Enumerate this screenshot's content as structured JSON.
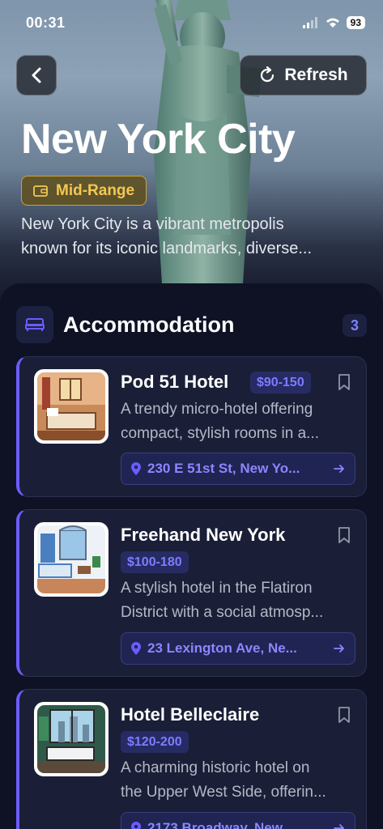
{
  "status_bar": {
    "time": "00:31",
    "battery": "93"
  },
  "header": {
    "refresh_label": "Refresh",
    "city": "New York City",
    "tier": "Mid-Range",
    "description_line1": "New York City is a vibrant metropolis",
    "description_line2": "known for its iconic landmarks, diverse..."
  },
  "section": {
    "title": "Accommodation",
    "count": "3"
  },
  "hotels": [
    {
      "name": "Pod 51 Hotel",
      "price": "$90-150",
      "desc_line1": "A trendy micro-hotel offering",
      "desc_line2": "compact, stylish rooms in a...",
      "address": "230 E 51st St, New Yo..."
    },
    {
      "name": "Freehand New York",
      "price": "$100-180",
      "desc_line1": "A stylish hotel in the Flatiron",
      "desc_line2": "District with a social atmosp...",
      "address": "23 Lexington Ave, Ne..."
    },
    {
      "name": "Hotel Belleclaire",
      "price": "$120-200",
      "desc_line1": "A charming historic hotel on",
      "desc_line2": "the Upper West Side, offerin...",
      "address": "2173 Broadway, New..."
    }
  ],
  "colors": {
    "accent": "#6a5cff",
    "tier_gold": "#f3c851",
    "panel_bg": "#0f1225",
    "card_bg": "#1a1f37"
  },
  "icons": [
    "chevron-left-icon",
    "refresh-icon",
    "wallet-icon",
    "bed-icon",
    "bookmark-icon",
    "location-pin-icon",
    "arrow-right-icon"
  ]
}
